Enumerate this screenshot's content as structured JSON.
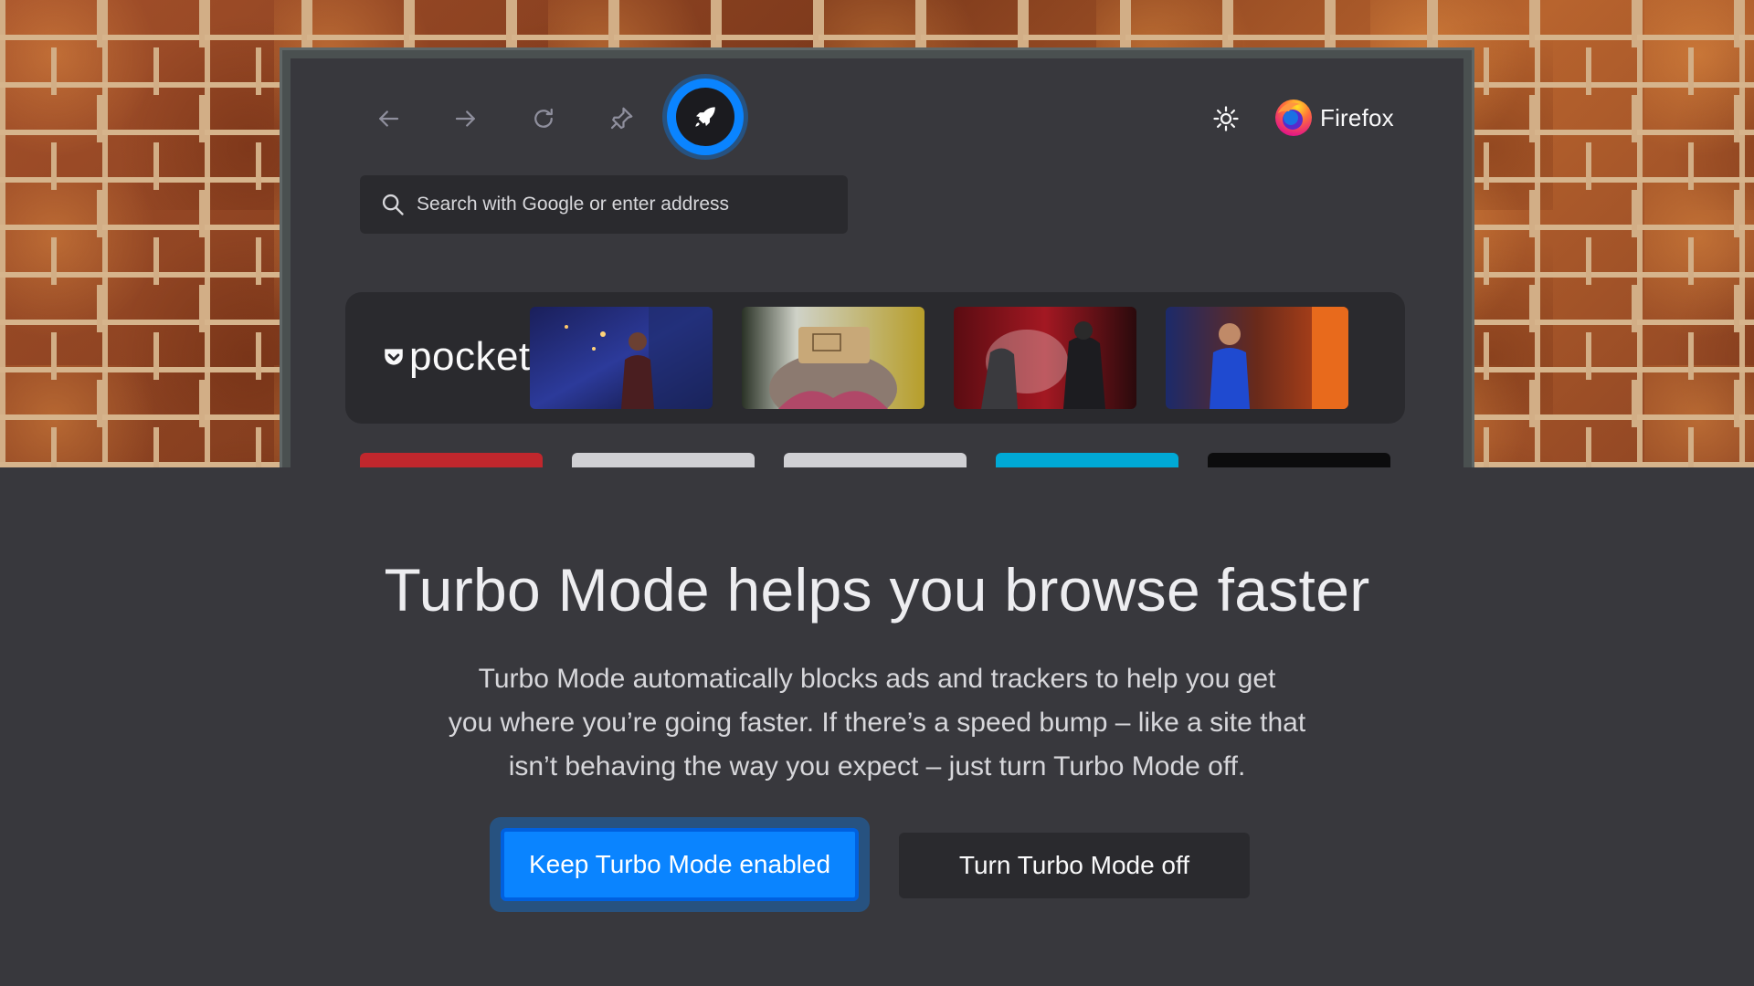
{
  "background": {
    "wall_color": "#9a4a26",
    "mortar_color": "#d2ae86"
  },
  "browser": {
    "nav": {
      "back_icon": "arrow-left-icon",
      "forward_icon": "arrow-right-icon",
      "reload_icon": "reload-icon",
      "pin_icon": "pin-icon",
      "turbo_icon": "rocket-icon",
      "settings_icon": "gear-icon"
    },
    "brand": {
      "name": "Firefox",
      "logo_icon": "firefox-logo-icon"
    },
    "search": {
      "placeholder": "Search with Google or enter address",
      "icon": "search-icon"
    },
    "pocket": {
      "word": "pocket",
      "logo_icon": "pocket-logo-icon",
      "tiles": [
        {
          "name": "pocket-tile-speaker-man"
        },
        {
          "name": "pocket-tile-vr-headset"
        },
        {
          "name": "pocket-tile-rescue-workers"
        },
        {
          "name": "pocket-tile-speaker-woman"
        }
      ]
    },
    "pinned_tiles": [
      {
        "color": "#c0272d"
      },
      {
        "color": "#d0d0d4"
      },
      {
        "color": "#d0d0d4"
      },
      {
        "color": "#00a9d6"
      },
      {
        "color": "#0c0c0d"
      }
    ]
  },
  "onboarding": {
    "headline": "Turbo Mode helps you browse faster",
    "body_lines": [
      "Turbo Mode automatically blocks ads and trackers to help you get",
      "you where you’re going faster. If there’s a speed bump – like a site that",
      "isn’t behaving the way you expect – just turn Turbo Mode off."
    ],
    "primary_button": "Keep Turbo Mode enabled",
    "secondary_button": "Turn Turbo Mode off"
  },
  "colors": {
    "accent": "#0a84ff",
    "panel": "#38383d",
    "surface": "#2a2a2e"
  }
}
